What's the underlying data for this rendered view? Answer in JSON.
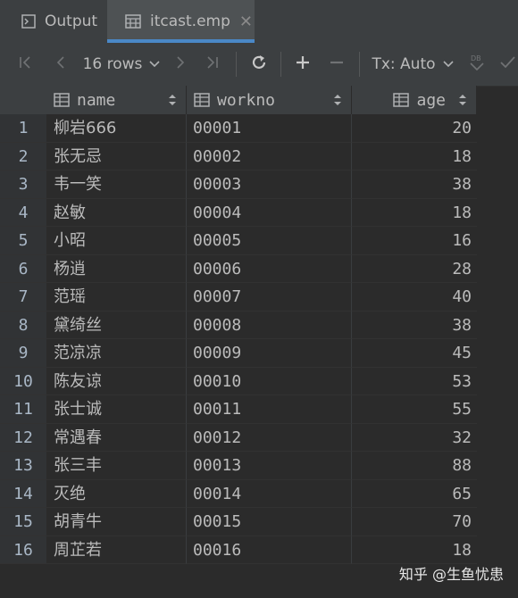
{
  "tabs": [
    {
      "label": "Output",
      "icon": "output-console-icon"
    },
    {
      "label": "itcast.emp",
      "icon": "table-grid-icon",
      "active": true
    }
  ],
  "toolbar": {
    "rows_label": "16 rows",
    "tx_label": "Tx: Auto",
    "icons": [
      "first-page-icon",
      "previous-page-icon",
      "next-page-icon",
      "last-page-icon",
      "refresh-icon",
      "add-row-icon",
      "delete-row-icon",
      "db-submit-icon",
      "commit-check-icon"
    ]
  },
  "table": {
    "columns": [
      "name",
      "workno",
      "age"
    ],
    "rows": [
      {
        "n": "1",
        "name": "柳岩666",
        "workno": "00001",
        "age": "20"
      },
      {
        "n": "2",
        "name": "张无忌",
        "workno": "00002",
        "age": "18"
      },
      {
        "n": "3",
        "name": "韦一笑",
        "workno": "00003",
        "age": "38"
      },
      {
        "n": "4",
        "name": "赵敏",
        "workno": "00004",
        "age": "18"
      },
      {
        "n": "5",
        "name": "小昭",
        "workno": "00005",
        "age": "16"
      },
      {
        "n": "6",
        "name": "杨逍",
        "workno": "00006",
        "age": "28"
      },
      {
        "n": "7",
        "name": "范瑶",
        "workno": "00007",
        "age": "40"
      },
      {
        "n": "8",
        "name": "黛绮丝",
        "workno": "00008",
        "age": "38"
      },
      {
        "n": "9",
        "name": "范凉凉",
        "workno": "00009",
        "age": "45"
      },
      {
        "n": "10",
        "name": "陈友谅",
        "workno": "00010",
        "age": "53"
      },
      {
        "n": "11",
        "name": "张士诚",
        "workno": "00011",
        "age": "55"
      },
      {
        "n": "12",
        "name": "常遇春",
        "workno": "00012",
        "age": "32"
      },
      {
        "n": "13",
        "name": "张三丰",
        "workno": "00013",
        "age": "88"
      },
      {
        "n": "14",
        "name": "灭绝",
        "workno": "00014",
        "age": "65"
      },
      {
        "n": "15",
        "name": "胡青牛",
        "workno": "00015",
        "age": "70"
      },
      {
        "n": "16",
        "name": "周芷若",
        "workno": "00016",
        "age": "18"
      }
    ]
  },
  "watermark": "知乎 @生鱼忧患",
  "colors": {
    "background": "#2b2b2b",
    "panel": "#3c3f41",
    "accent": "#4a88c7",
    "text": "#bbbbbb"
  }
}
